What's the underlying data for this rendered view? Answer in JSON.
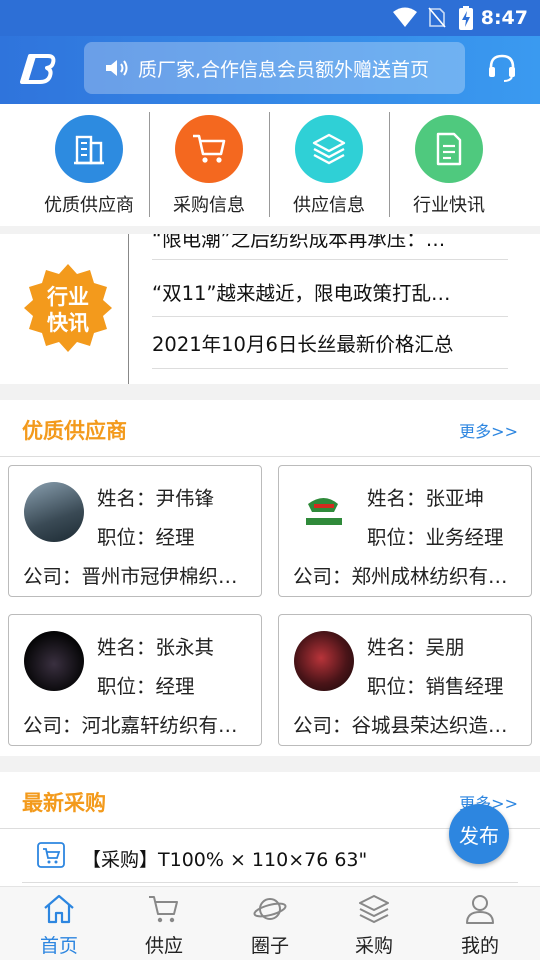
{
  "status_bar": {
    "time": "8:47"
  },
  "header": {
    "notice_text": "质厂家,合作信息会员额外赠送首页"
  },
  "quick_nav": [
    {
      "label": "优质供应商",
      "color": "#2d8be0",
      "icon": "building-icon"
    },
    {
      "label": "采购信息",
      "color": "#f4681f",
      "icon": "cart-icon"
    },
    {
      "label": "供应信息",
      "color": "#2fd0d6",
      "icon": "layers-icon"
    },
    {
      "label": "行业快讯",
      "color": "#4fc97e",
      "icon": "document-icon"
    }
  ],
  "news": {
    "badge_line1": "行业",
    "badge_line2": "快讯",
    "items": [
      "“限电潮”之后纺织成本再承压：…",
      "“双11”越来越近，限电政策打乱…",
      "2021年10月6日长丝最新价格汇总"
    ]
  },
  "suppliers_section": {
    "title": "优质供应商",
    "more": "更多>>",
    "cards": [
      {
        "name": "姓名：尹伟锋",
        "position": "职位：经理",
        "company": "公司：晋州市冠伊棉织有限公司"
      },
      {
        "name": "姓名：张亚坤",
        "position": "职位：业务经理",
        "company": "公司：郑州成林纺织有限公司"
      },
      {
        "name": "姓名：张永其",
        "position": "职位：经理",
        "company": "公司：河北嘉轩纺织有限公司"
      },
      {
        "name": "姓名：吴朋",
        "position": "职位：销售经理",
        "company": "公司：谷城县荣达织造有限公司"
      }
    ]
  },
  "purchase_section": {
    "title": "最新采购",
    "more": "更多>>",
    "item": "【采购】T100% × 110×76 63\""
  },
  "fab_label": "发布",
  "tabs": [
    {
      "label": "首页",
      "icon": "home-icon",
      "active": true
    },
    {
      "label": "供应",
      "icon": "cart-icon"
    },
    {
      "label": "圈子",
      "icon": "planet-icon"
    },
    {
      "label": "采购",
      "icon": "layers-icon"
    },
    {
      "label": "我的",
      "icon": "user-icon"
    }
  ],
  "colors": {
    "accent": "#2d86e0",
    "header": "#2f74dc",
    "section_title": "#f39a1c",
    "badge": "#f39a1c"
  }
}
